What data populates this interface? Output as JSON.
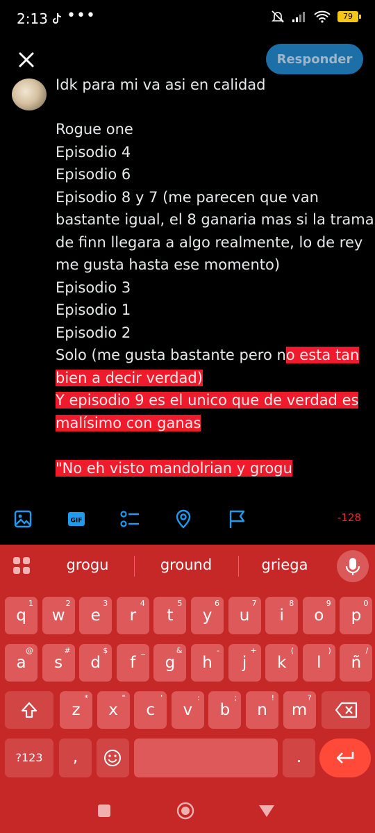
{
  "status": {
    "time": "2:13",
    "dots": "•••",
    "battery": "79"
  },
  "header": {
    "reply_label": "Responder"
  },
  "quoted": {
    "cut_text": "Idk para mi va asi en calidad"
  },
  "compose": {
    "lines": [
      {
        "t": "Rogue one"
      },
      {
        "t": "Episodio 4"
      },
      {
        "t": "Episodio 6"
      },
      {
        "t": "Episodio 8 y 7 (me parecen que van"
      },
      {
        "t": "bastante igual, el 8 ganaria mas si la trama"
      },
      {
        "t": "de finn llegara a algo realmente, lo de rey"
      },
      {
        "t": "me gusta hasta ese momento)"
      },
      {
        "t": "Episodio 3"
      },
      {
        "t": "Episodio 1"
      },
      {
        "t": "Episodio 2"
      },
      {
        "t": "Solo (me gusta bastante pero n",
        "h": "o esta tan"
      },
      {
        "h": "bien a decir verdad)"
      },
      {
        "h": "Y episodio 9 es el unico que de verdad es"
      },
      {
        "h": "malísimo con ganas"
      },
      {
        "t": ""
      },
      {
        "h": "\"No eh visto mandolrian y grogu"
      }
    ]
  },
  "toolbar": {
    "counter": "-128"
  },
  "keyboard": {
    "suggestions": [
      "grogu",
      "ground",
      "griega"
    ],
    "row1": [
      {
        "k": "q",
        "s": "1"
      },
      {
        "k": "w",
        "s": "2"
      },
      {
        "k": "e",
        "s": "3"
      },
      {
        "k": "r",
        "s": "4"
      },
      {
        "k": "t",
        "s": "5"
      },
      {
        "k": "y",
        "s": "6"
      },
      {
        "k": "u",
        "s": "7"
      },
      {
        "k": "i",
        "s": "8"
      },
      {
        "k": "o",
        "s": "9"
      },
      {
        "k": "p",
        "s": "0"
      }
    ],
    "row2": [
      {
        "k": "a",
        "s": "@"
      },
      {
        "k": "s",
        "s": "#"
      },
      {
        "k": "d",
        "s": "$"
      },
      {
        "k": "f",
        "s": "_"
      },
      {
        "k": "g",
        "s": "&"
      },
      {
        "k": "h",
        "s": "-"
      },
      {
        "k": "j",
        "s": "+"
      },
      {
        "k": "k",
        "s": "("
      },
      {
        "k": "l",
        "s": ")"
      },
      {
        "k": "ñ",
        "s": "/"
      }
    ],
    "row3": [
      {
        "k": "z",
        "s": "*"
      },
      {
        "k": "x",
        "s": "\""
      },
      {
        "k": "c",
        "s": "'"
      },
      {
        "k": "v",
        "s": ":"
      },
      {
        "k": "b",
        "s": ";"
      },
      {
        "k": "n",
        "s": "!"
      },
      {
        "k": "m",
        "s": "?"
      }
    ],
    "symbols_label": "?123",
    "comma_label": ",",
    "period_label": "."
  },
  "colors": {
    "accent": "#1d9bf0",
    "highlight": "#ef1a2b",
    "keyboard_bg": "#c62828",
    "key_bg": "#de5a5a"
  }
}
